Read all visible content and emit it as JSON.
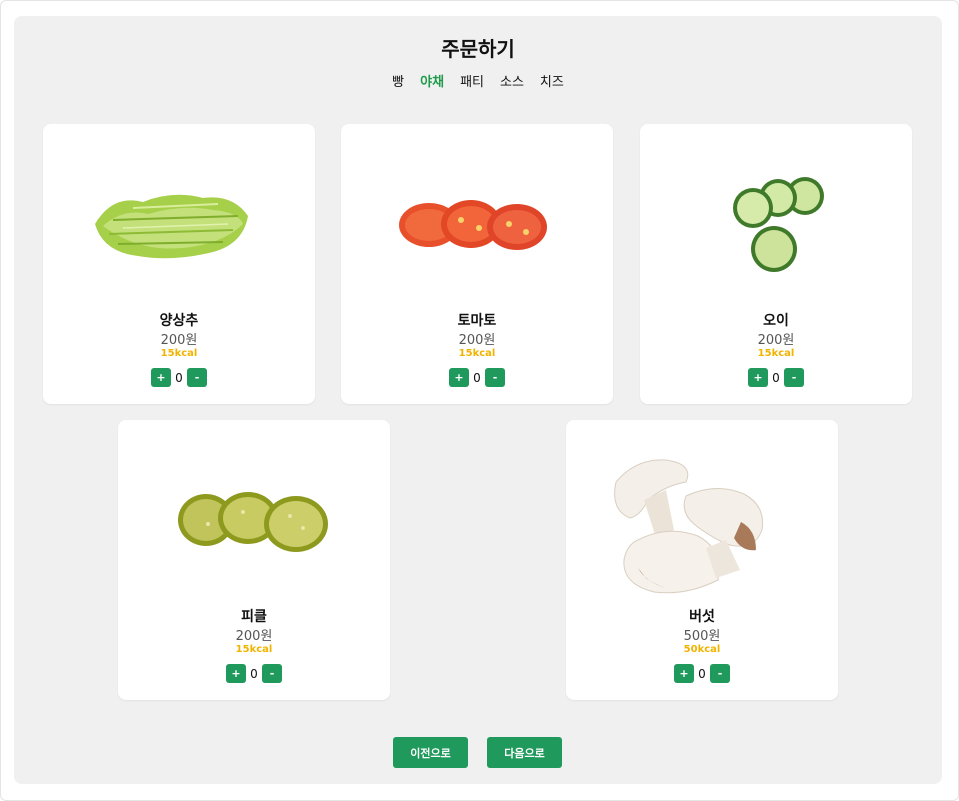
{
  "page": {
    "title": "주문하기"
  },
  "tabs": [
    {
      "label": "빵",
      "active": false
    },
    {
      "label": "야채",
      "active": true
    },
    {
      "label": "패티",
      "active": false
    },
    {
      "label": "소스",
      "active": false
    },
    {
      "label": "치즈",
      "active": false
    }
  ],
  "items": [
    {
      "name": "양상추",
      "price": "200원",
      "kcal": "15kcal",
      "count": "0",
      "image_icon": "lettuce-image"
    },
    {
      "name": "토마토",
      "price": "200원",
      "kcal": "15kcal",
      "count": "0",
      "image_icon": "tomato-image"
    },
    {
      "name": "오이",
      "price": "200원",
      "kcal": "15kcal",
      "count": "0",
      "image_icon": "cucumber-image"
    },
    {
      "name": "피클",
      "price": "200원",
      "kcal": "15kcal",
      "count": "0",
      "image_icon": "pickle-image"
    },
    {
      "name": "버섯",
      "price": "500원",
      "kcal": "50kcal",
      "count": "0",
      "image_icon": "mushroom-image"
    }
  ],
  "controls": {
    "plus_label": "+",
    "minus_label": "-"
  },
  "nav": {
    "prev_label": "이전으로",
    "next_label": "다음으로"
  },
  "colors": {
    "accent": "#1f9a5c",
    "active_tab": "#1e9a4a",
    "kcal": "#f0b400",
    "panel_bg": "#f0f0f0"
  }
}
